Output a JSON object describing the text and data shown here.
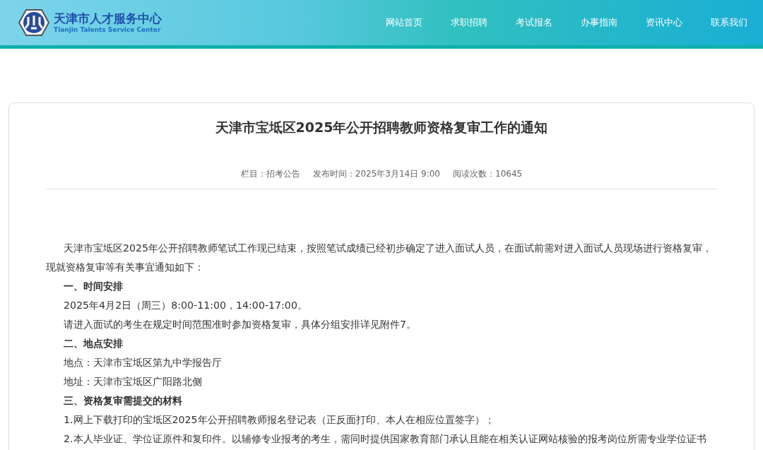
{
  "header": {
    "logo_title": "天津市人才服务中心",
    "logo_subtitle": "Tianjin Talents Service Center",
    "nav": [
      {
        "label": "网站首页"
      },
      {
        "label": "求职招聘"
      },
      {
        "label": "考试报名"
      },
      {
        "label": "办事指南"
      },
      {
        "label": "资讯中心"
      },
      {
        "label": "联系我们"
      }
    ]
  },
  "article": {
    "title": "天津市宝坻区2025年公开招聘教师资格复审工作的通知",
    "meta": [
      "栏目：招考公告",
      "发布时间：2025年3月14日 9:00",
      "阅读次数：10645"
    ],
    "body": [
      {
        "kind": "para",
        "text": "天津市宝坻区2025年公开招聘教师笔试工作现已结束，按照笔试成绩已经初步确定了进入面试人员，在面试前需对进入面试人员现场进行资格复审，现就资格复审等有关事宜通知如下："
      },
      {
        "kind": "heading",
        "text": "一、时间安排"
      },
      {
        "kind": "line",
        "text": "2025年4月2日（周三）8:00-11:00，14:00-17:00。"
      },
      {
        "kind": "line",
        "text": "请进入面试的考生在规定时间范围准时参加资格复审，具体分组安排详见附件7。"
      },
      {
        "kind": "heading",
        "text": "二、地点安排"
      },
      {
        "kind": "line",
        "text": "地点：天津市宝坻区第九中学报告厅"
      },
      {
        "kind": "line",
        "text": "地址：天津市宝坻区广阳路北侧"
      },
      {
        "kind": "heading",
        "text": "三、资格复审需提交的材料"
      },
      {
        "kind": "line",
        "text": "1.网上下载打印的宝坻区2025年公开招聘教师报名登记表（正反面打印、本人在相应位置签字）；"
      },
      {
        "kind": "line",
        "text": "2.本人毕业证、学位证原件和复印件。以辅修专业报考的考生，需同时提供国家教育部门承认且能在相关认证网站核验的报考岗位所需专业学位证书"
      }
    ]
  }
}
